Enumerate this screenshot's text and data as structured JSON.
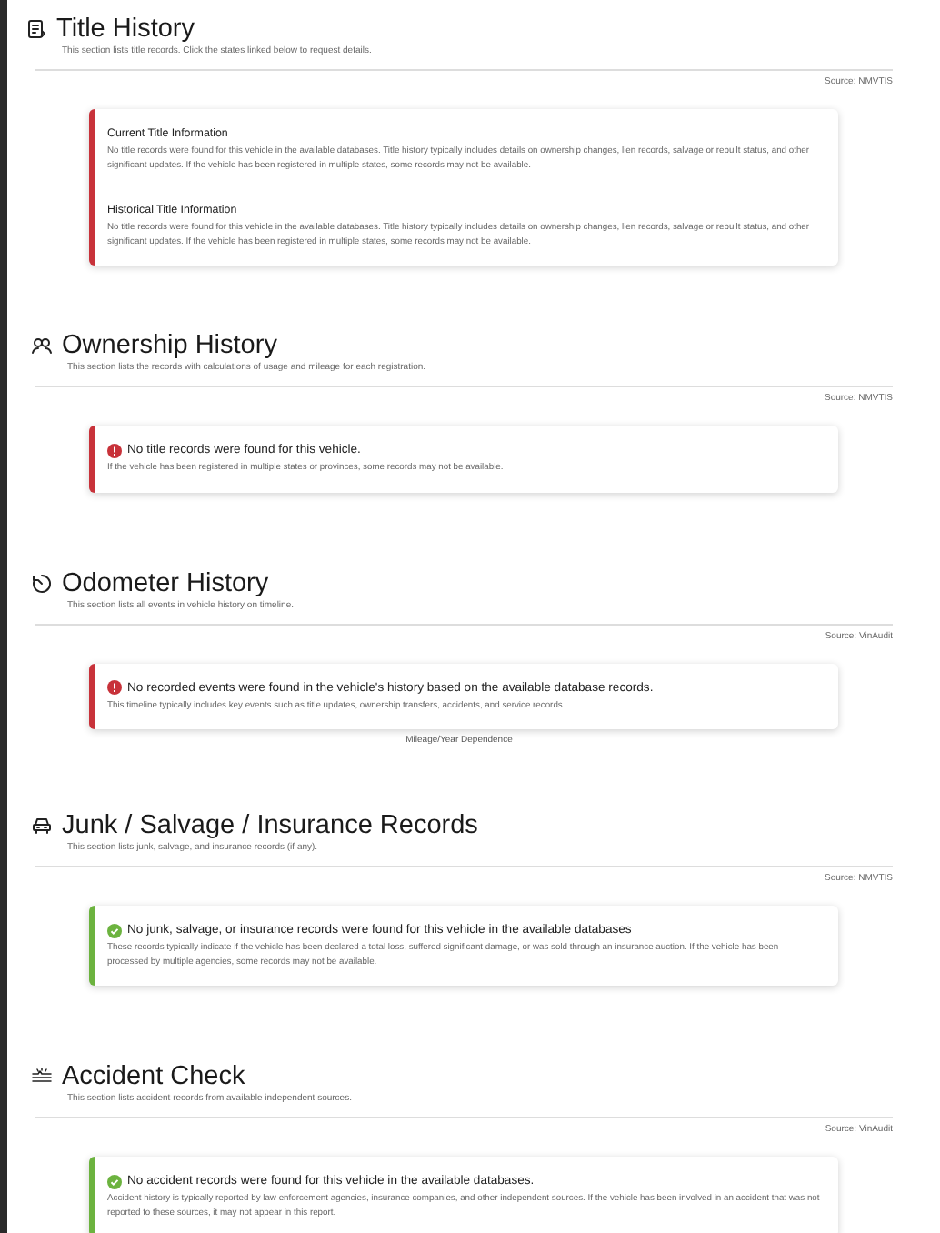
{
  "sections": [
    {
      "kind": "document",
      "title": "Title History",
      "subtitle": "This section lists title records. Click the states linked below to request details.",
      "source": "Source: NMVTIS",
      "card": {
        "kind": "notice",
        "color": "#c8323a",
        "items": [
          {
            "heading": "Current Title Information",
            "body": "No title records were found for this vehicle in the available databases. Title history typically includes details on ownership changes, lien records, salvage or rebuilt status, and other significant updates. If the vehicle has been registered in multiple states, some records may not be available."
          },
          {
            "heading": "Historical Title Information",
            "body": "No title records were found for this vehicle in the available databases. Title history typically includes details on ownership changes, lien records, salvage or rebuilt status, and other significant updates. If the vehicle has been registered in multiple states, some records may not be available."
          }
        ]
      }
    },
    {
      "kind": "people",
      "title": "Ownership History",
      "subtitle": "This section lists the records with calculations of usage and mileage for each registration.",
      "source": "Source: NMVTIS",
      "card": {
        "kind": "error",
        "color": "#c8323a",
        "items": [
          {
            "heading": "No title records were found for this vehicle.",
            "body": "If the vehicle has been registered in multiple states or provinces, some records may not be available."
          }
        ]
      }
    },
    {
      "kind": "timer",
      "title": "Odometer History",
      "subtitle": "This section lists all events in vehicle history on timeline.",
      "source": "Source: VinAudit",
      "card": {
        "kind": "error",
        "color": "#c8323a",
        "items": [
          {
            "heading": "No recorded events were found in the vehicle's history based on the available database records.",
            "body": "This timeline typically includes key events such as title updates, ownership transfers, accidents, and service records."
          }
        ]
      },
      "caption": "Mileage/Year Dependence"
    },
    {
      "kind": "car",
      "title": "Junk / Salvage / Insurance Records",
      "subtitle": "This section lists junk, salvage, and insurance records (if any).",
      "source": "Source: NMVTIS",
      "card": {
        "kind": "success",
        "color": "#6cb33f",
        "items": [
          {
            "heading": "No junk, salvage, or insurance records were found for this vehicle in the available databases",
            "body": "These records typically indicate if the vehicle has been declared a total loss, suffered significant damage, or was sold through an insurance auction. If the vehicle has been processed by multiple agencies, some records may not be available."
          }
        ]
      }
    },
    {
      "kind": "crash",
      "title": "Accident Check",
      "subtitle": "This section lists accident records from available independent sources.",
      "source": "Source: VinAudit",
      "card": {
        "kind": "success",
        "color": "#6cb33f",
        "items": [
          {
            "heading": "No accident records were found for this vehicle in the available databases.",
            "body": "Accident history is typically reported by law enforcement agencies, insurance companies, and other independent sources. If the vehicle has been involved in an accident that was not reported to these sources, it may not appear in this report."
          }
        ]
      }
    }
  ]
}
